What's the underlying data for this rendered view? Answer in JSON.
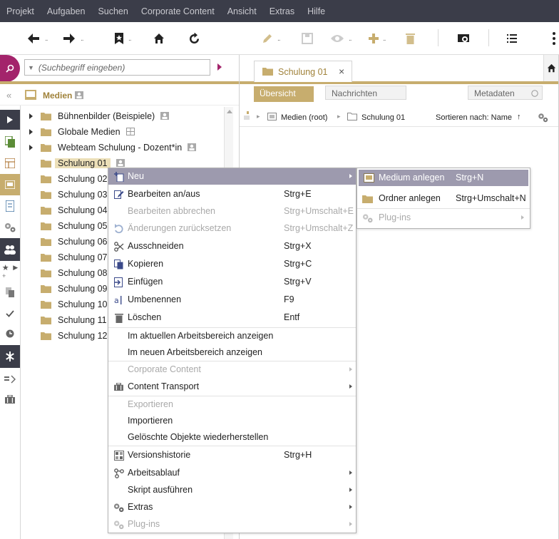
{
  "menubar": [
    "Projekt",
    "Aufgaben",
    "Suchen",
    "Corporate Content",
    "Ansicht",
    "Extras",
    "Hilfe"
  ],
  "toolbar": {
    "dots": ".."
  },
  "search": {
    "placeholder": "(Suchbegriff eingeben)"
  },
  "panel": {
    "title": "Medien"
  },
  "tree": [
    {
      "label": "Bühnenbilder (Beispiele)",
      "expandable": true
    },
    {
      "label": "Globale Medien",
      "expandable": true
    },
    {
      "label": "Webteam Schulung - Dozent*in",
      "expandable": true
    },
    {
      "label": "Schulung 01",
      "expandable": false,
      "selected": true
    },
    {
      "label": "Schulung 02",
      "expandable": false
    },
    {
      "label": "Schulung 03",
      "expandable": false
    },
    {
      "label": "Schulung 04",
      "expandable": false
    },
    {
      "label": "Schulung 05",
      "expandable": false
    },
    {
      "label": "Schulung 06",
      "expandable": false
    },
    {
      "label": "Schulung 07",
      "expandable": false
    },
    {
      "label": "Schulung 08",
      "expandable": false
    },
    {
      "label": "Schulung 09",
      "expandable": false
    },
    {
      "label": "Schulung 10",
      "expandable": false
    },
    {
      "label": "Schulung 11",
      "expandable": false
    },
    {
      "label": "Schulung 12",
      "expandable": false
    }
  ],
  "doctab": {
    "label": "Schulung 01",
    "close": "×"
  },
  "subtabs": {
    "overview": "Übersicht",
    "messages": "Nachrichten",
    "metadata": "Metadaten"
  },
  "breadcrumb": {
    "root": "Medien (root)",
    "current": "Schulung 01",
    "sort": "Sortieren nach: Name",
    "sort_dir": "↑"
  },
  "context_menu": {
    "new": "Neu",
    "edit_toggle": "Bearbeiten an/aus",
    "edit_toggle_sc": "Strg+E",
    "edit_cancel": "Bearbeiten abbrechen",
    "edit_cancel_sc": "Strg+Umschalt+E",
    "revert": "Änderungen zurücksetzen",
    "revert_sc": "Strg+Umschalt+Z",
    "cut": "Ausschneiden",
    "cut_sc": "Strg+X",
    "copy": "Kopieren",
    "copy_sc": "Strg+C",
    "paste": "Einfügen",
    "paste_sc": "Strg+V",
    "rename": "Umbenennen",
    "rename_sc": "F9",
    "delete": "Löschen",
    "delete_sc": "Entf",
    "show_current_ws": "Im aktuellen Arbeitsbereich anzeigen",
    "show_new_ws": "Im neuen Arbeitsbereich anzeigen",
    "corporate_content": "Corporate Content",
    "content_transport": "Content Transport",
    "export": "Exportieren",
    "import": "Importieren",
    "restore_deleted": "Gelöschte Objekte wiederherstellen",
    "version_history": "Versionshistorie",
    "version_history_sc": "Strg+H",
    "workflow": "Arbeitsablauf",
    "run_script": "Skript ausführen",
    "extras": "Extras",
    "plugins": "Plug-ins"
  },
  "submenu_new": {
    "create_medium": "Medium anlegen",
    "create_medium_sc": "Strg+N",
    "create_folder": "Ordner anlegen",
    "create_folder_sc": "Strg+Umschalt+N",
    "plugins": "Plug-ins"
  },
  "colors": {
    "menubar_bg": "#3b3d49",
    "accent_gold": "#c7ad6e",
    "brand_magenta": "#a3246b",
    "highlight": "#9d9aae"
  }
}
